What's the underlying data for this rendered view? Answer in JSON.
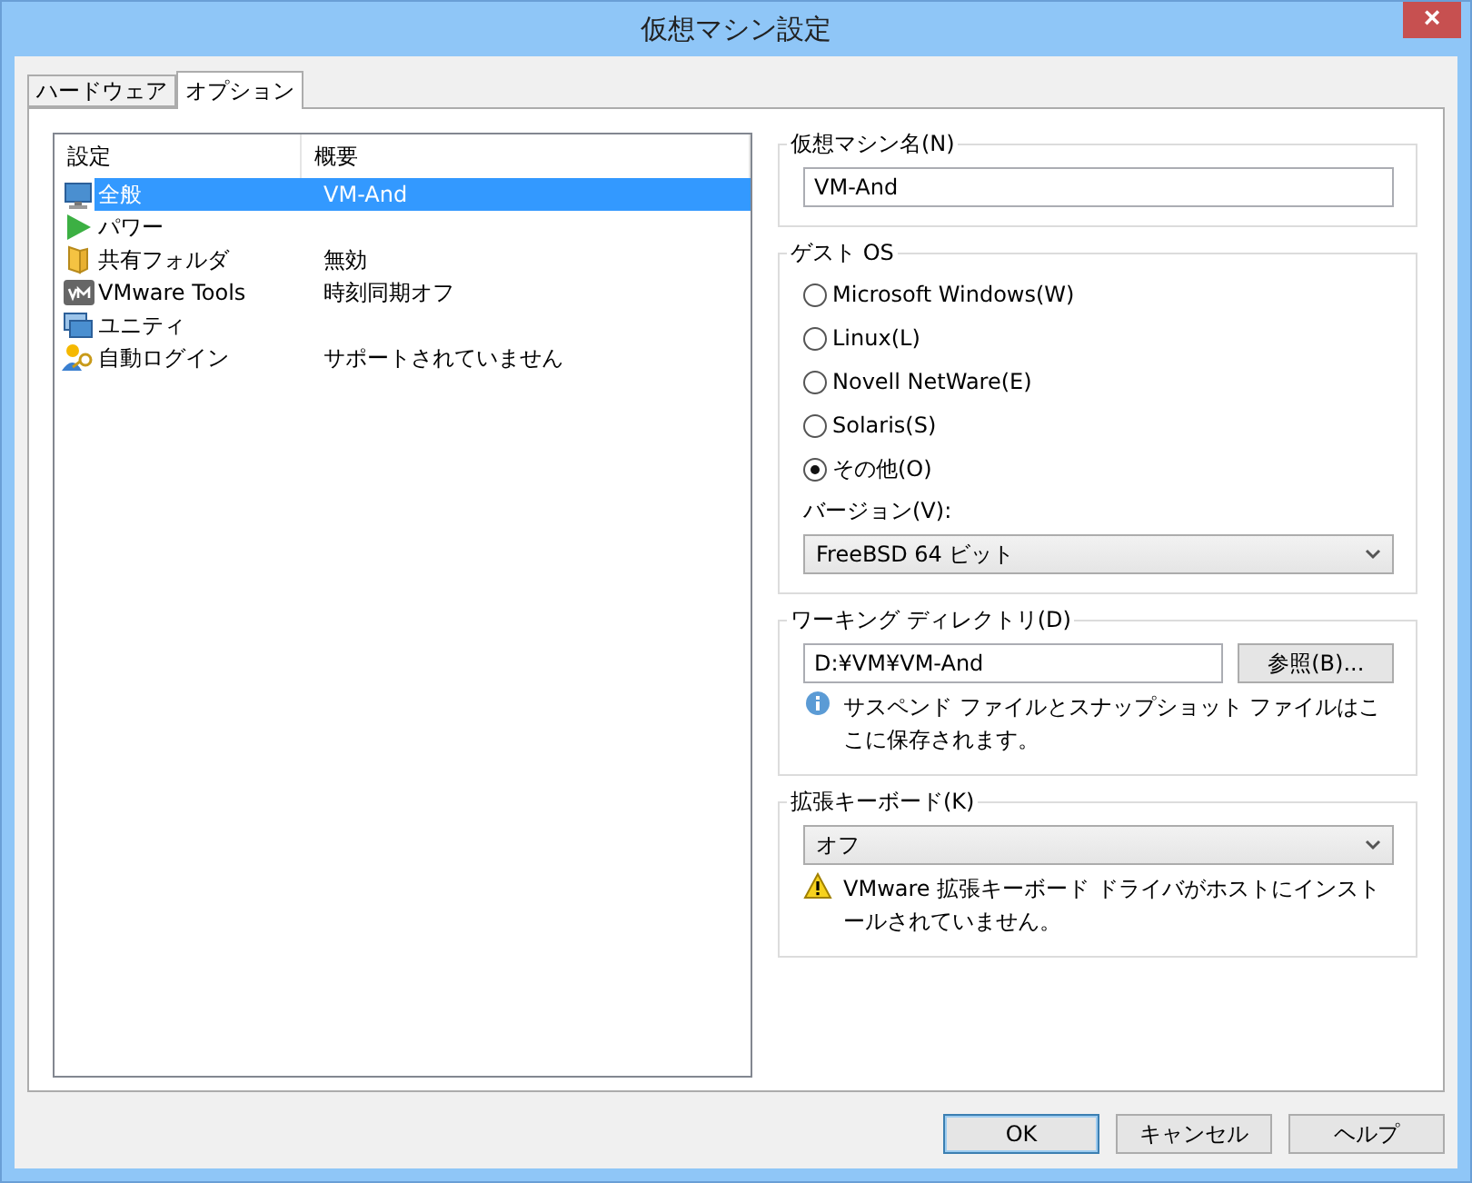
{
  "window": {
    "title": "仮想マシン設定",
    "close": "×"
  },
  "tabs": [
    {
      "label": "ハードウェア",
      "selected": false
    },
    {
      "label": "オプション",
      "selected": true
    }
  ],
  "settings_list": {
    "columns": [
      "設定",
      "概要"
    ],
    "rows": [
      {
        "name": "全般",
        "summary": "VM-And",
        "selected": true
      },
      {
        "name": "パワー",
        "selected": false
      },
      {
        "name": "共有フォルダ",
        "summary": "無効",
        "selected": false
      },
      {
        "name": "VMware Tools",
        "summary": "時刻同期オフ",
        "selected": false
      },
      {
        "name": "ユニティ",
        "selected": false
      },
      {
        "name": "自動ログイン",
        "summary": "サポートされていません",
        "selected": false
      }
    ]
  },
  "vm_name": {
    "label": "仮想マシン名(N)",
    "value": "VM-And"
  },
  "guest_os": {
    "label": "ゲスト OS",
    "options": [
      {
        "label": "Microsoft Windows(W)",
        "selected": false
      },
      {
        "label": "Linux(L)",
        "selected": false
      },
      {
        "label": "Novell NetWare(E)",
        "selected": false
      },
      {
        "label": "Solaris(S)",
        "selected": false
      },
      {
        "label": "その他(O)",
        "selected": true
      }
    ],
    "version_label": "バージョン(V):",
    "version": "FreeBSD 64 ビット"
  },
  "working_directory": {
    "label": "ワーキング ディレクトリ(D)",
    "value": "D:¥VM¥VM-And",
    "browse": "参照(B)...",
    "info": "サスペンド ファイルとスナップショット ファイルはここに保存されます。"
  },
  "enhanced_keyboard": {
    "label": "拡張キーボード(K)",
    "value": "オフ",
    "warning": "VMware 拡張キーボード ドライバがホストにインストールされていません。"
  },
  "buttons": [
    {
      "label": "OK",
      "default": true
    },
    {
      "label": "キャンセル",
      "default": false
    },
    {
      "label": "ヘルプ",
      "default": false
    }
  ]
}
